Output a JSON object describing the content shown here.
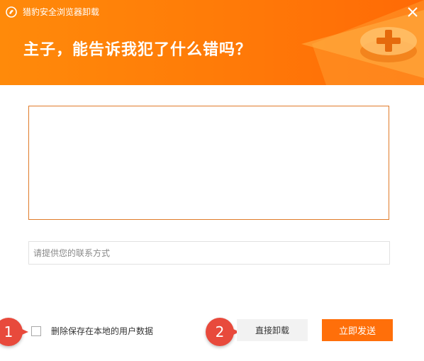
{
  "window": {
    "title": "猎豹安全浏览器卸载",
    "headline": "主子，能告诉我犯了什么错吗？",
    "logo_icon": "cheetah-logo-icon",
    "close_icon": "close-icon"
  },
  "form": {
    "feedback_value": "",
    "contact_placeholder": "请提供您的联系方式",
    "checkbox_label": "删除保存在本地的用户数据",
    "checkbox_checked": false
  },
  "buttons": {
    "uninstall_label": "直接卸载",
    "send_label": "立即发送"
  },
  "annotations": {
    "badge_1": "1",
    "badge_2": "2"
  },
  "colors": {
    "brand_orange": "#ff7a08",
    "send_button": "#ff6f0a",
    "badge_red": "#e84a3c"
  }
}
